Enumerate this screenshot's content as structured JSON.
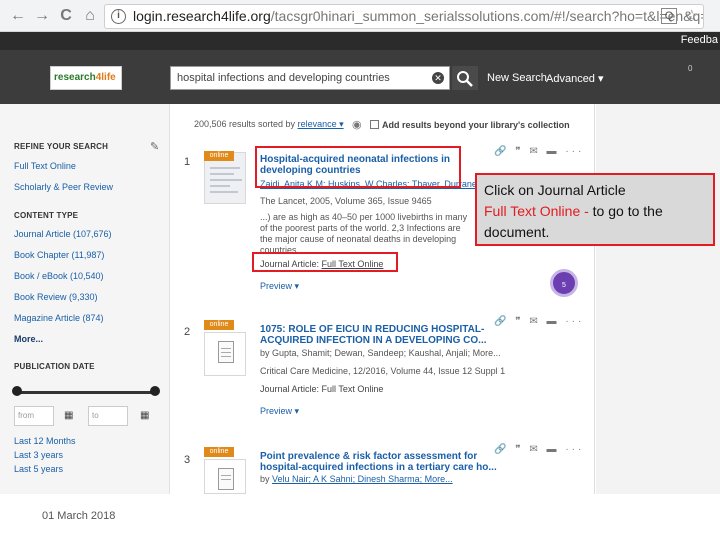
{
  "browser": {
    "back_icon": "←",
    "forward_icon": "→",
    "reload_icon": "C",
    "home_icon": "⌂",
    "info_icon": "i",
    "host": "login.research4life.org",
    "path": "/tacsgr0hinari_summon_serialssolutions.com/#!/search?ho=t&l=en&q=hosp...",
    "extension_icon": "Q",
    "star_icon": "☆"
  },
  "top_strip": {
    "feedback": "Feedba"
  },
  "header": {
    "logo_part1": "research",
    "logo_part2": "4life",
    "search_value": "hospital infections and developing countries",
    "clear_icon": "✕",
    "new_search": "New Search",
    "advanced": "Advanced ▾",
    "badge": "0"
  },
  "sidebar": {
    "refine_heading": "REFINE YOUR SEARCH",
    "full_text_online": "Full Text Online",
    "scholarly": "Scholarly & Peer Review",
    "content_type_heading": "CONTENT TYPE",
    "content_types": [
      "Journal Article (107,676)",
      "Book Chapter (11,987)",
      "Book / eBook (10,540)",
      "Book Review (9,330)",
      "Magazine Article (874)"
    ],
    "more": "More...",
    "pub_date_heading": "PUBLICATION DATE",
    "from_placeholder": "from",
    "to_placeholder": "to",
    "calendar_icon": "▦",
    "date_presets": [
      "Last 12 Months",
      "Last 3 years",
      "Last 5 years"
    ]
  },
  "results": {
    "count_text": "200,506 results sorted by",
    "sort_value": "relevance ▾",
    "rss_icon": "◉",
    "beyond_label": "Add results beyond your library's collection",
    "actions_icons": "🔗 ❞ ✉ ▬ ···",
    "items": [
      {
        "num": "1",
        "badge": "online",
        "title_prefix": "Hospital-",
        "title_rest": "acquired neonatal infections in developing countries",
        "authors": "Zaidi, Anita K M; Huskins, W Charles; Thaver, Durrane...",
        "source": "The Lancet, 2005, Volume 365, Issue 9465",
        "snippet": "...) are as high as 40–50 per 1000 livebirths in many of the poorest parts of the world. 2,3 Infections are the major cause of neonatal deaths in developing countries...",
        "jtype_label": "Journal Article:",
        "jtype_link": "Full Text Online",
        "preview": "Preview ▾",
        "altmetric": "5"
      },
      {
        "num": "2",
        "badge": "online",
        "title": "1075: ROLE OF EICU IN REDUCING HOSPITAL-ACQUIRED INFECTION IN A DEVELOPING CO...",
        "authors": "by Gupta, Shamit; Dewan, Sandeep; Kaushal, Anjali; More...",
        "source": "Critical Care Medicine, 12/2016, Volume 44, Issue 12 Suppl 1",
        "jtype": "Journal Article: Full Text Online",
        "preview": "Preview ▾"
      },
      {
        "num": "3",
        "badge": "online",
        "title": "Point prevalence & risk factor assessment for hospital-acquired infections in a tertiary care ho...",
        "authors_prefix": "by",
        "authors": "Velu Nair; A K Sahni; Dinesh Sharma; More..."
      }
    ]
  },
  "callout": {
    "line1": "Click on Journal Article",
    "highlight": "Full Text Online - ",
    "line2": "to go to the document."
  },
  "footer": {
    "date": "01 March 2018"
  }
}
